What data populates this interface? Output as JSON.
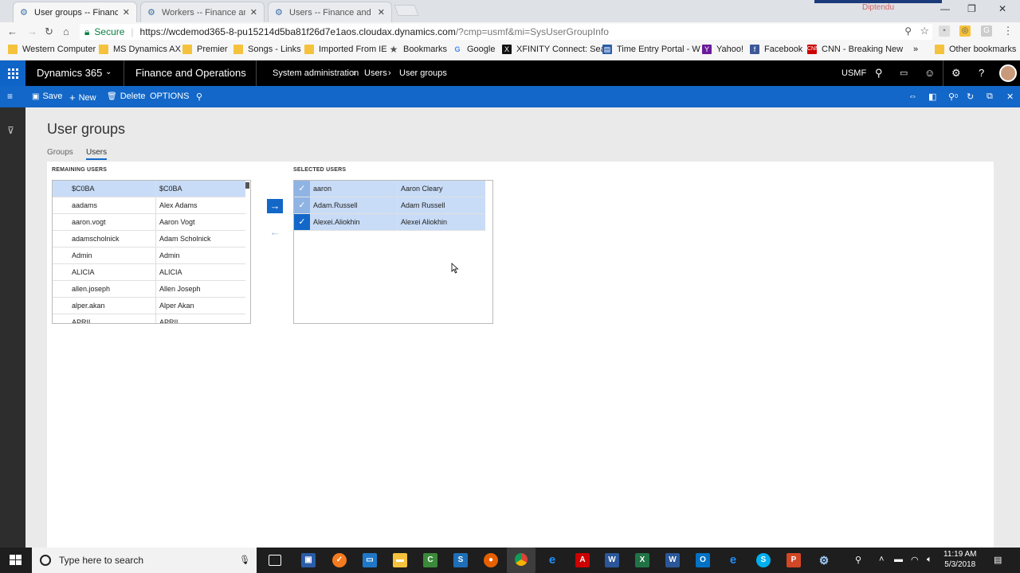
{
  "browser": {
    "tabs": [
      {
        "title": "User groups -- Finance a",
        "active": true
      },
      {
        "title": "Workers -- Finance and (",
        "active": false
      },
      {
        "title": "Users -- Finance and Op",
        "active": false
      }
    ],
    "profile_name": "Diptendu",
    "secure_label": "Secure",
    "url_host": "https://wcdemod365-8-pu15214d5ba81f26d7e1aos.cloudax.dynamics.com",
    "url_path": "/?cmp=usmf&mi=SysUserGroupInfo",
    "bookmarks": [
      {
        "label": "Western Computer",
        "icon": "folder"
      },
      {
        "label": "MS Dynamics AX",
        "icon": "folder"
      },
      {
        "label": "Premier",
        "icon": "folder"
      },
      {
        "label": "Songs - Links",
        "icon": "folder"
      },
      {
        "label": "Imported From IE",
        "icon": "folder"
      },
      {
        "label": "Bookmarks",
        "icon": "star"
      },
      {
        "label": "Google",
        "icon": "google"
      },
      {
        "label": "XFINITY Connect: Sea",
        "icon": "xfinity"
      },
      {
        "label": "Time Entry Portal - W",
        "icon": "portal"
      },
      {
        "label": "Yahoo!",
        "icon": "yahoo"
      },
      {
        "label": "Facebook",
        "icon": "facebook"
      },
      {
        "label": "CNN - Breaking New",
        "icon": "cnn"
      }
    ],
    "more_bookmarks": "»",
    "other_bookmarks": "Other bookmarks"
  },
  "app": {
    "product": "Dynamics 365",
    "module": "Finance and Operations",
    "breadcrumb": [
      "System administration",
      "Users",
      "User groups"
    ],
    "company": "USMF"
  },
  "actions": {
    "save": "Save",
    "new": "New",
    "delete": "Delete",
    "options": "OPTIONS"
  },
  "page": {
    "title": "User groups",
    "tabs": [
      "Groups",
      "Users"
    ],
    "remaining_label": "REMAINING USERS",
    "selected_label": "SELECTED USERS",
    "remaining_users": [
      {
        "id": "$C0BA",
        "name": "$C0BA"
      },
      {
        "id": "aadams",
        "name": "Alex Adams"
      },
      {
        "id": "aaron.vogt",
        "name": "Aaron Vogt"
      },
      {
        "id": "adamscholnick",
        "name": "Adam Scholnick"
      },
      {
        "id": "Admin",
        "name": "Admin"
      },
      {
        "id": "ALICIA",
        "name": "ALICIA"
      },
      {
        "id": "allen.joseph",
        "name": "Allen Joseph"
      },
      {
        "id": "alper.akan",
        "name": "Alper Akan"
      },
      {
        "id": "APRIL",
        "name": "APRIL"
      }
    ],
    "selected_users": [
      {
        "id": "aaron",
        "name": "Aaron Cleary"
      },
      {
        "id": "Adam.Russell",
        "name": "Adam Russell"
      },
      {
        "id": "Alexei.Aliokhin",
        "name": "Alexei Aliokhin"
      }
    ]
  },
  "taskbar": {
    "search_placeholder": "Type here to search",
    "time": "11:19 AM",
    "date": "5/3/2018"
  },
  "colors": {
    "accent": "#1267c8",
    "nav_bg": "#000000",
    "highlight": "#c8dcf7"
  }
}
